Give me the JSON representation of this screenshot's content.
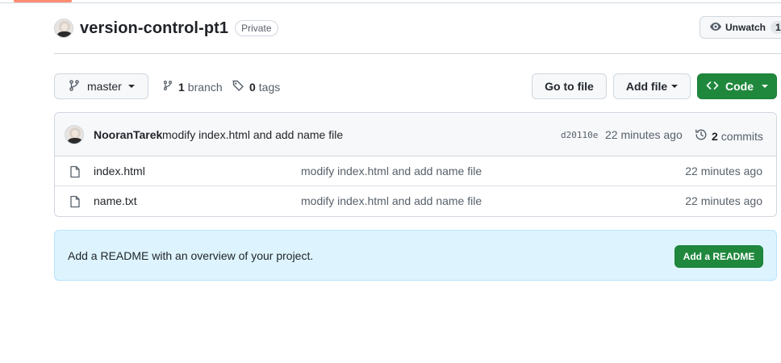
{
  "repo": {
    "name": "version-control-pt1",
    "visibility": "Private"
  },
  "watch": {
    "label": "Unwatch",
    "count": "1"
  },
  "toolbar": {
    "branch": "master",
    "branches_count": "1",
    "branches_label": "branch",
    "tags_count": "0",
    "tags_label": "tags",
    "goto_file": "Go to file",
    "add_file": "Add file",
    "code": "Code"
  },
  "latest_commit": {
    "author": "NooranTarek",
    "message": "modify index.html and add name file",
    "sha": "d20110e",
    "time": "22 minutes ago",
    "commits_count": "2",
    "commits_label": "commits"
  },
  "files": [
    {
      "name": "index.html",
      "commit": "modify index.html and add name file",
      "time": "22 minutes ago"
    },
    {
      "name": "name.txt",
      "commit": "modify index.html and add name file",
      "time": "22 minutes ago"
    }
  ],
  "readme": {
    "message": "Add a README with an overview of your project.",
    "button": "Add a README"
  },
  "colors": {
    "primary_green": "#1f883d",
    "banner_blue": "#ddf4ff",
    "tab_accent": "#fd8c73"
  }
}
